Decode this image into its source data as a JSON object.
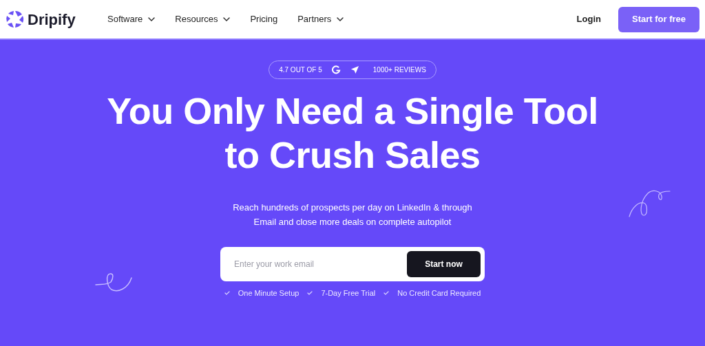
{
  "brand": {
    "name": "Dripify"
  },
  "nav": [
    {
      "label": "Software",
      "has_menu": true
    },
    {
      "label": "Resources",
      "has_menu": true
    },
    {
      "label": "Pricing",
      "has_menu": false
    },
    {
      "label": "Partners",
      "has_menu": true
    }
  ],
  "login": "Login",
  "cta": "Start for free",
  "rating": {
    "score": "4.7 OUT OF 5",
    "reviews": "1000+ REVIEWS"
  },
  "headline": [
    "You Only Need a Single Tool",
    "to Crush Sales"
  ],
  "subtitle": [
    "Reach hundreds of prospects per day on LinkedIn & through",
    "Email and close more deals on complete autopilot"
  ],
  "signup": {
    "placeholder": "Enter your work email",
    "button": "Start now"
  },
  "features": [
    "One Minute Setup",
    "7-Day Free Trial",
    "No Credit Card Required"
  ]
}
